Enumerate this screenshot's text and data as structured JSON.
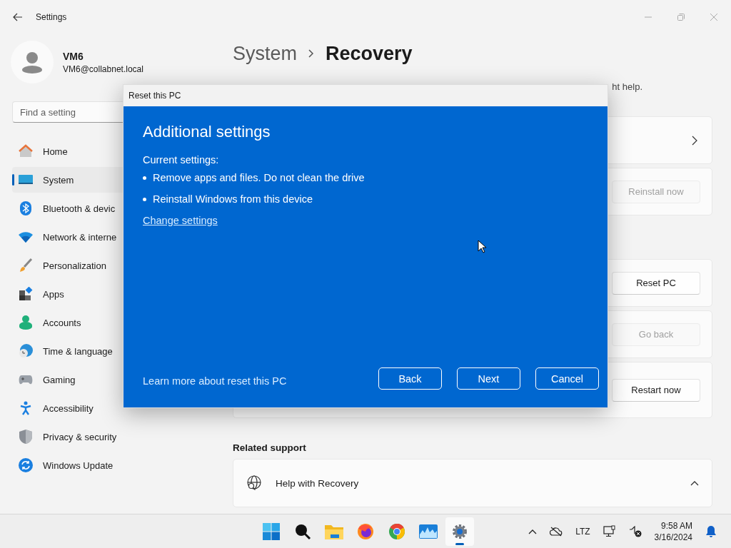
{
  "window": {
    "title": "Settings"
  },
  "profile": {
    "name": "VM6",
    "email": "VM6@collabnet.local"
  },
  "search": {
    "placeholder": "Find a setting"
  },
  "nav": [
    {
      "label": "Home",
      "kind": "home",
      "selected": false
    },
    {
      "label": "System",
      "kind": "system",
      "selected": true
    },
    {
      "label": "Bluetooth & devic",
      "kind": "bluetooth",
      "selected": false
    },
    {
      "label": "Network & interne",
      "kind": "network",
      "selected": false
    },
    {
      "label": "Personalization",
      "kind": "personalization",
      "selected": false
    },
    {
      "label": "Apps",
      "kind": "apps",
      "selected": false
    },
    {
      "label": "Accounts",
      "kind": "accounts",
      "selected": false
    },
    {
      "label": "Time & language",
      "kind": "time",
      "selected": false
    },
    {
      "label": "Gaming",
      "kind": "gaming",
      "selected": false
    },
    {
      "label": "Accessibility",
      "kind": "accessibility",
      "selected": false
    },
    {
      "label": "Privacy & security",
      "kind": "privacy",
      "selected": false
    },
    {
      "label": "Windows Update",
      "kind": "update",
      "selected": false
    }
  ],
  "breadcrumb": {
    "parent": "System",
    "current": "Recovery"
  },
  "description": "ht help.",
  "card_groups": [
    [
      {
        "kind": "chevron"
      },
      {
        "kind": "button",
        "button": "Reinstall now",
        "disabled": true
      }
    ],
    [
      {
        "kind": "button",
        "button": "Reset PC",
        "disabled": false
      },
      {
        "kind": "button",
        "button": "Go back",
        "disabled": true
      },
      {
        "kind": "button",
        "button": "Restart now",
        "disabled": false
      }
    ]
  ],
  "related_support": {
    "heading": "Related support",
    "items": [
      {
        "label": "Help with Recovery",
        "expanded": true
      }
    ]
  },
  "dialog": {
    "title": "Reset this PC",
    "heading": "Additional settings",
    "subheading": "Current settings:",
    "bullets": [
      "Remove apps and files. Do not clean the drive",
      "Reinstall Windows from this device"
    ],
    "link": "Change settings",
    "learn_more": "Learn more about reset this PC",
    "buttons": [
      "Back",
      "Next",
      "Cancel"
    ]
  },
  "taskbar": {
    "apps": [
      {
        "kind": "start",
        "active": false
      },
      {
        "kind": "search",
        "active": false
      },
      {
        "kind": "folder",
        "active": false
      },
      {
        "kind": "firefox",
        "active": false
      },
      {
        "kind": "chrome",
        "active": false
      },
      {
        "kind": "monitor",
        "active": false
      },
      {
        "kind": "settings",
        "active": true
      }
    ],
    "language": "LTZ",
    "time": "9:58 AM",
    "date": "3/16/2024"
  }
}
